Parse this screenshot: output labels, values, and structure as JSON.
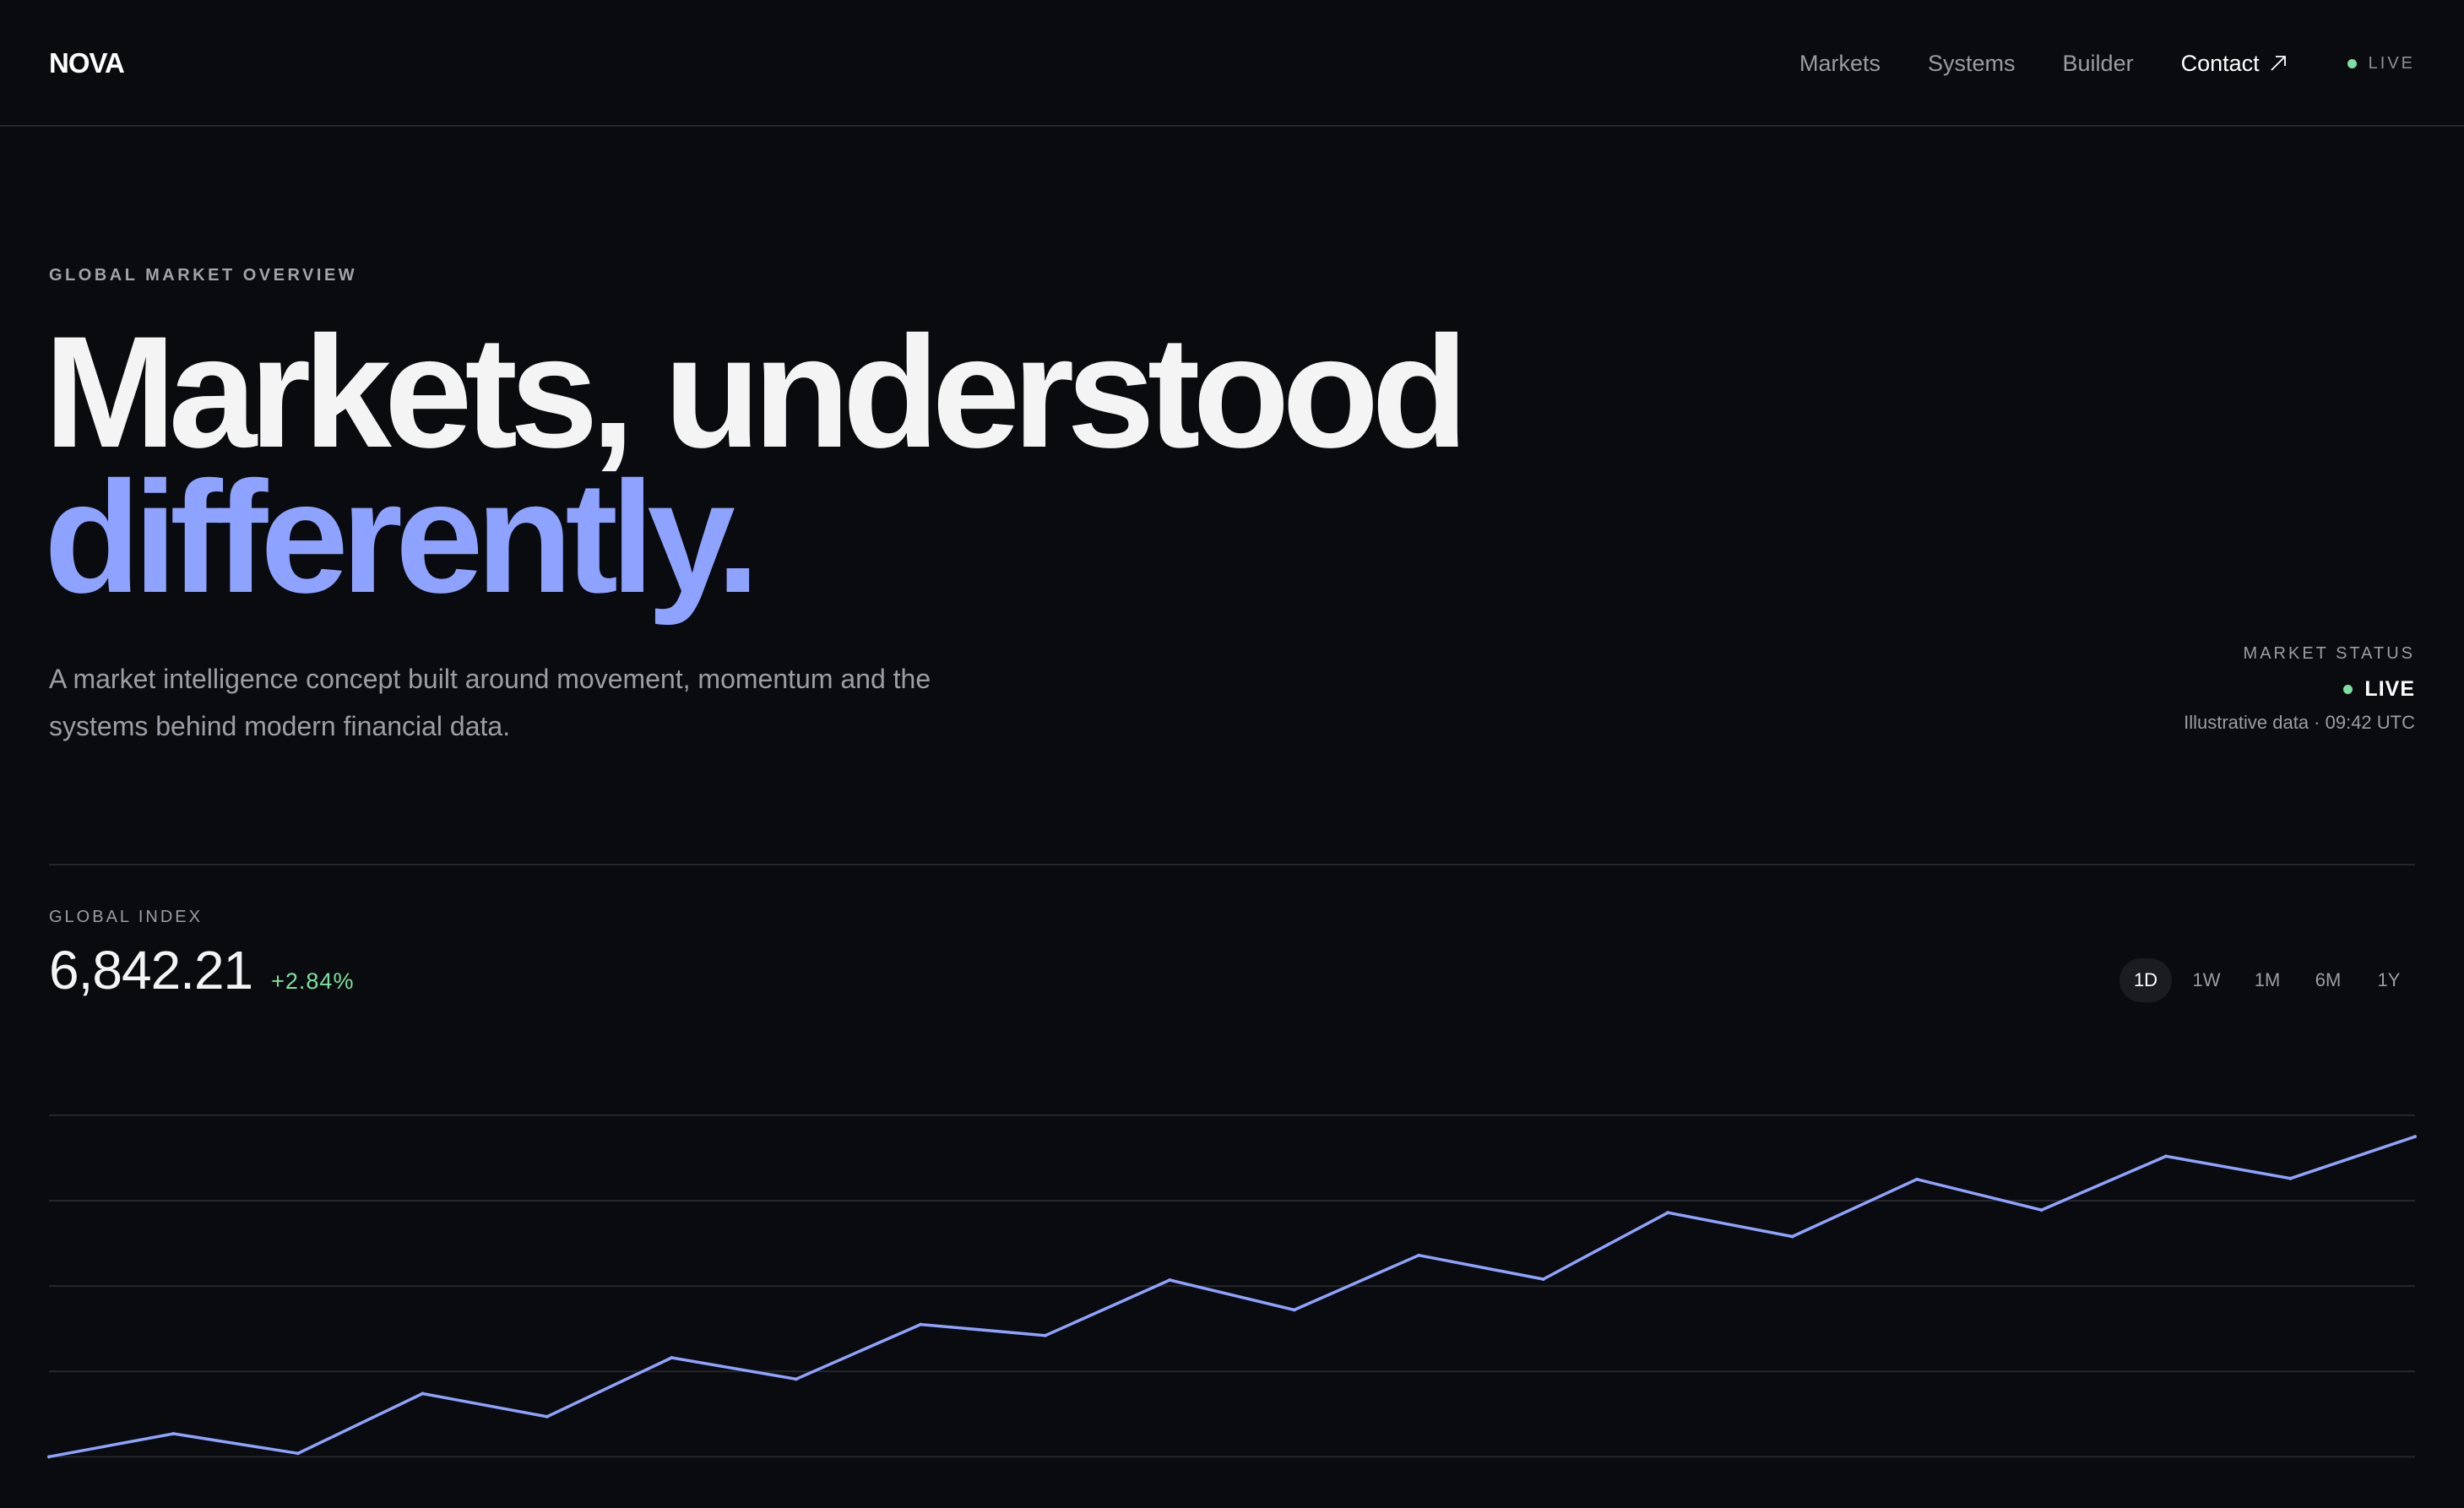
{
  "header": {
    "brand": "NOVA",
    "nav": [
      "Markets",
      "Systems",
      "Builder"
    ],
    "contact": "Contact",
    "live_label": "LIVE"
  },
  "hero": {
    "eyebrow": "GLOBAL MARKET OVERVIEW",
    "headline_line1": "Markets, understood",
    "headline_line2": "differently.",
    "lede": "A market intelligence concept built around movement, momentum and the systems behind modern financial data."
  },
  "status": {
    "label": "MARKET STATUS",
    "value": "LIVE",
    "meta": "Illustrative data · 09:42 UTC"
  },
  "index": {
    "label": "GLOBAL INDEX",
    "value": "6,842.21",
    "change": "+2.84%"
  },
  "ranges": [
    "1D",
    "1W",
    "1M",
    "6M",
    "1Y"
  ],
  "active_range": "1D",
  "colors": {
    "accent": "#8ea2ff",
    "positive": "#7ee0a0",
    "background": "#0a0b0e"
  },
  "icons": {
    "contact": "arrow-up-right-icon",
    "live": "status-dot-icon"
  },
  "chart_data": {
    "type": "line",
    "title": "",
    "xlabel": "",
    "ylabel": "",
    "x": [
      0,
      1,
      2,
      3,
      4,
      5,
      6,
      7,
      8,
      9,
      10,
      11,
      12,
      13,
      14,
      15,
      16,
      17,
      18,
      19
    ],
    "values": [
      0.0,
      0.27,
      0.04,
      0.74,
      0.47,
      1.16,
      0.91,
      1.55,
      1.42,
      2.07,
      1.72,
      2.36,
      2.08,
      2.86,
      2.58,
      3.25,
      2.89,
      3.52,
      3.26,
      3.75
    ],
    "ylim": [
      -0.6,
      4.8
    ],
    "gridlines": [
      0,
      1,
      2,
      3,
      4
    ],
    "grid": true,
    "legend": "none"
  }
}
